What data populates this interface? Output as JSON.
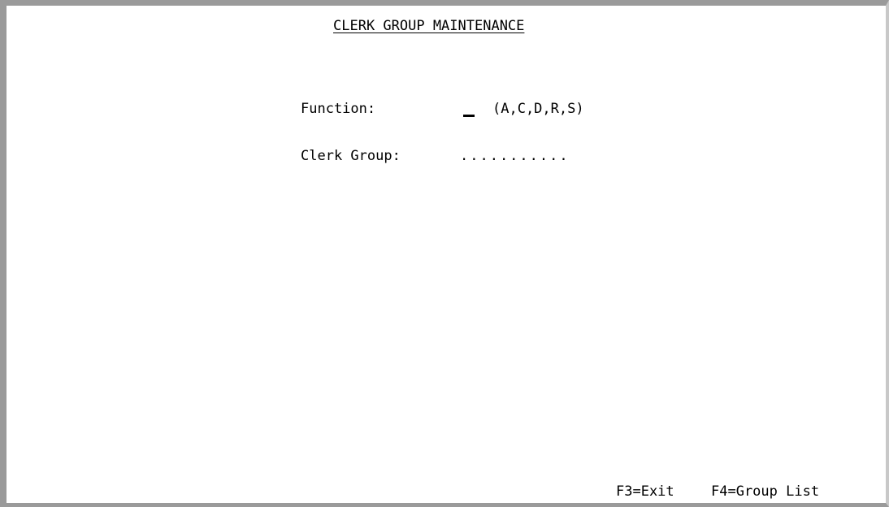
{
  "header": {
    "title": "CLERK GROUP MAINTENANCE"
  },
  "form": {
    "function": {
      "label": "Function:",
      "value": "",
      "options_hint": "(A,C,D,R,S)"
    },
    "clerk_group": {
      "label": "Clerk Group:",
      "value": "",
      "placeholder": "..........."
    }
  },
  "footer": {
    "fkeys": [
      "F3=Exit",
      "F4=Group List"
    ]
  },
  "colors": {
    "frame": "#9a9a9a",
    "background": "#ffffff",
    "text": "#000000"
  }
}
